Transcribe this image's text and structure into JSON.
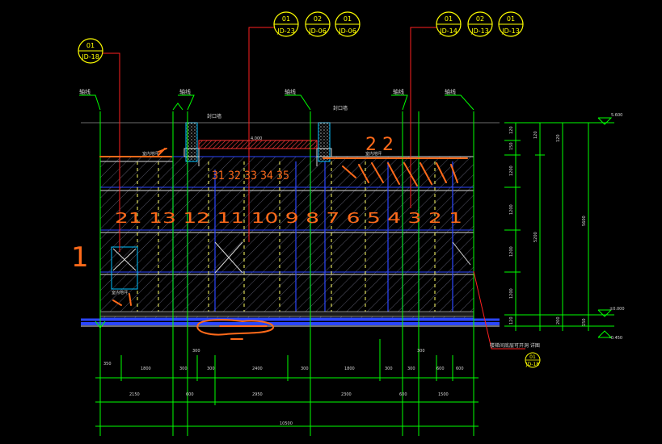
{
  "drawing": {
    "background": "#000000",
    "colors": {
      "green": "#00ff00",
      "red": "#ff2020",
      "yellow": "#ffff00",
      "orange": "#ff6600",
      "blue": "#2040ff",
      "cyan": "#00c0ff",
      "white": "#d8d8d8",
      "hatch": "#5a5a6a",
      "slab": "#d42020"
    },
    "callouts": {
      "left": {
        "num": "01",
        "ref": "JD-18"
      },
      "middle": [
        {
          "num": "01",
          "ref": "JD-23"
        },
        {
          "num": "02",
          "ref": "JD-06"
        },
        {
          "num": "01",
          "ref": "JD-06"
        }
      ],
      "right": [
        {
          "num": "01",
          "ref": "JD-14"
        },
        {
          "num": "02",
          "ref": "JD-13"
        },
        {
          "num": "01",
          "ref": "JD-13"
        }
      ],
      "bottom": {
        "num": "01",
        "ref": "JD-18"
      }
    },
    "axis_labels": [
      "轴线",
      "轴线",
      "轴线",
      "轴线",
      "轴线"
    ],
    "small_labels": {
      "seal_left": "封口墙",
      "seal_right": "封口墙",
      "room_left": "室内地坪",
      "room_right": "室内地坪",
      "room_bottom": "室内地坪",
      "slab_dim": "4,000",
      "bottom_note": "楼梯间底层可开洞 详图"
    },
    "elevation_top": "5.600",
    "elevation_mid": "±0.000",
    "elevation_bottom": "-0.450",
    "right_dims_inner": [
      "120",
      "150",
      "1200",
      "1200",
      "1200",
      "1200",
      "120"
    ],
    "right_dims_mid": [
      "120",
      "5200",
      "200"
    ],
    "right_dims_outer": [
      "5600",
      "150"
    ],
    "bottom_dims_row1": [
      "350",
      "1800",
      "300",
      "300",
      "2400",
      "300",
      "1800",
      "300",
      "300",
      "600",
      "600"
    ],
    "bottom_dims_row1b": [
      "300",
      "300"
    ],
    "bottom_dims_row2": [
      "2150",
      "600",
      "2950",
      "2300",
      "600",
      "1500"
    ],
    "total_width": "10500",
    "handwriting": {
      "big_one": "1",
      "two_two": "2 2",
      "row_numbers": "21 13 12 11 10 9 8 7 6 5 4 3 2 1",
      "stair_numbers": "31 32 33 34 35"
    }
  }
}
